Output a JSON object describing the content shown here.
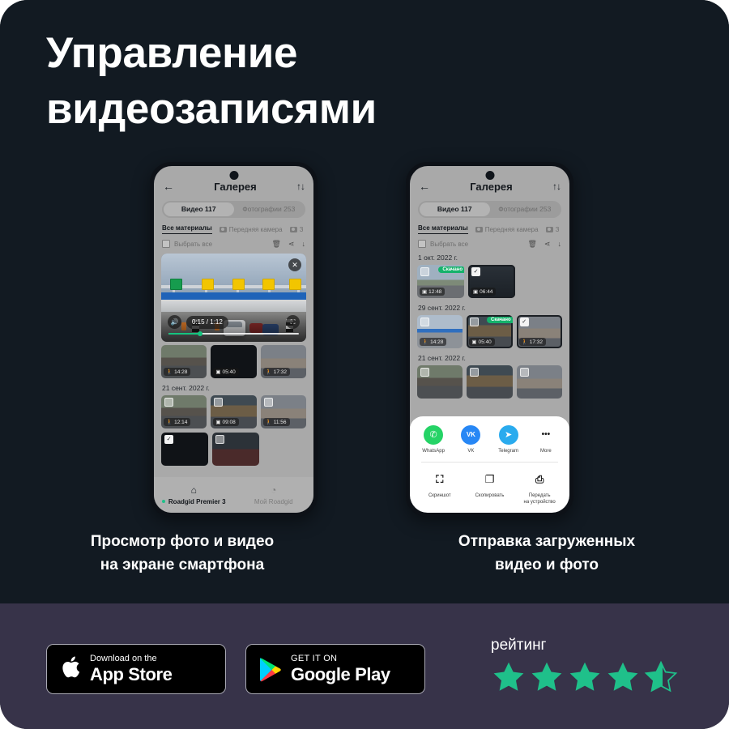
{
  "hero": {
    "title_line1": "Управление",
    "title_line2": "видеозаписями"
  },
  "colors": {
    "hero_bg": "#121a22",
    "footer_bg": "#373349",
    "accent_green": "#1fc08a",
    "badge_green": "#15b26b",
    "player_progress": "#15c47f"
  },
  "phone1": {
    "header": {
      "back_icon": "←",
      "title": "Галерея",
      "sort_icon": "↑↓"
    },
    "segments": [
      {
        "label": "Видео 117",
        "active": true
      },
      {
        "label": "Фотографии 253",
        "active": false
      }
    ],
    "filter_tabs": [
      {
        "label": "Все материалы",
        "active": true
      },
      {
        "label": "Передняя камера",
        "active": false
      },
      {
        "label": "З",
        "active": false
      }
    ],
    "select_all": {
      "label": "Выбрать все",
      "delete_icon": "🗑",
      "share_icon": "⋖",
      "download_icon": "↓"
    },
    "player": {
      "time": "0:15 / 1:12",
      "volume_icon": "🔊",
      "fullscreen_icon": "⛶",
      "close_icon": "✕",
      "progress_percent": 24
    },
    "strip_thumbs": [
      {
        "time": "14:28",
        "icon": "walk"
      },
      {
        "time": "05:40",
        "icon": "cam"
      },
      {
        "time": "17:32",
        "icon": "walk"
      }
    ],
    "date_label": "21 сент. 2022 г.",
    "grid_thumbs": [
      {
        "time": "12:14",
        "icon": "walk",
        "checked": false
      },
      {
        "time": "09:08",
        "icon": "cam",
        "checked": false
      },
      {
        "time": "11:56",
        "icon": "walk",
        "checked": false
      }
    ],
    "bottom_nav": [
      {
        "label": "Roadgid Premier 3",
        "icon": "⌂",
        "active": true
      },
      {
        "label": "Мой Roadgid",
        "icon": "◔",
        "active": false
      }
    ]
  },
  "phone2": {
    "header": {
      "back_icon": "←",
      "title": "Галерея",
      "sort_icon": "↑↓"
    },
    "segments": [
      {
        "label": "Видео 117",
        "active": true
      },
      {
        "label": "Фотографии 253",
        "active": false
      }
    ],
    "filter_tabs": [
      {
        "label": "Все материалы",
        "active": true
      },
      {
        "label": "Передняя камера",
        "active": false
      },
      {
        "label": "З",
        "active": false
      }
    ],
    "select_all": {
      "label": "Выбрать все",
      "delete_icon": "🗑",
      "share_icon": "⋖",
      "download_icon": "↓"
    },
    "groups": [
      {
        "date": "1 окт. 2022 г.",
        "thumbs": [
          {
            "time": "12:48",
            "icon": "cam",
            "checked": false,
            "badge": "Скачано"
          },
          {
            "time": "06:44",
            "icon": "cam",
            "checked": true,
            "badge": ""
          }
        ]
      },
      {
        "date": "29 сент. 2022 г.",
        "thumbs": [
          {
            "time": "14:28",
            "icon": "walk",
            "checked": false,
            "badge": ""
          },
          {
            "time": "05:40",
            "icon": "cam",
            "checked": false,
            "badge": "Скачано"
          },
          {
            "time": "17:32",
            "icon": "walk",
            "checked": true,
            "badge": ""
          }
        ]
      },
      {
        "date": "21 сент. 2022 г.",
        "thumbs": [
          {
            "time": "",
            "icon": "walk",
            "checked": false,
            "badge": ""
          },
          {
            "time": "",
            "icon": "cam",
            "checked": false,
            "badge": ""
          },
          {
            "time": "",
            "icon": "walk",
            "checked": false,
            "badge": ""
          }
        ]
      }
    ],
    "share_sheet": {
      "apps": [
        {
          "label": "WhatsApp",
          "glyph": "✆",
          "color": "#25D366"
        },
        {
          "label": "VK",
          "glyph": "VK",
          "color": "#2787F5"
        },
        {
          "label": "Telegram",
          "glyph": "➤",
          "color": "#2AABEE"
        },
        {
          "label": "More",
          "glyph": "•••",
          "color": "#ffffff"
        }
      ],
      "tools": [
        {
          "label": "Скриншот",
          "glyph": "⛶"
        },
        {
          "label": "Скопировать",
          "glyph": "❐"
        },
        {
          "label": "Передать\nна устройство",
          "glyph": "⎙"
        }
      ]
    }
  },
  "captions": [
    "Просмотр фото и видео\nна экране смартфона",
    "Отправка загруженных\nвидео и фото"
  ],
  "footer": {
    "app_store": {
      "small": "Download on the",
      "big": "App Store",
      "icon": "apple-logo"
    },
    "google_play": {
      "small": "GET IT ON",
      "big": "Google Play",
      "icon": "play-triangle"
    },
    "rating": {
      "label": "рейтинг",
      "value": 4.5,
      "max": 5
    }
  }
}
